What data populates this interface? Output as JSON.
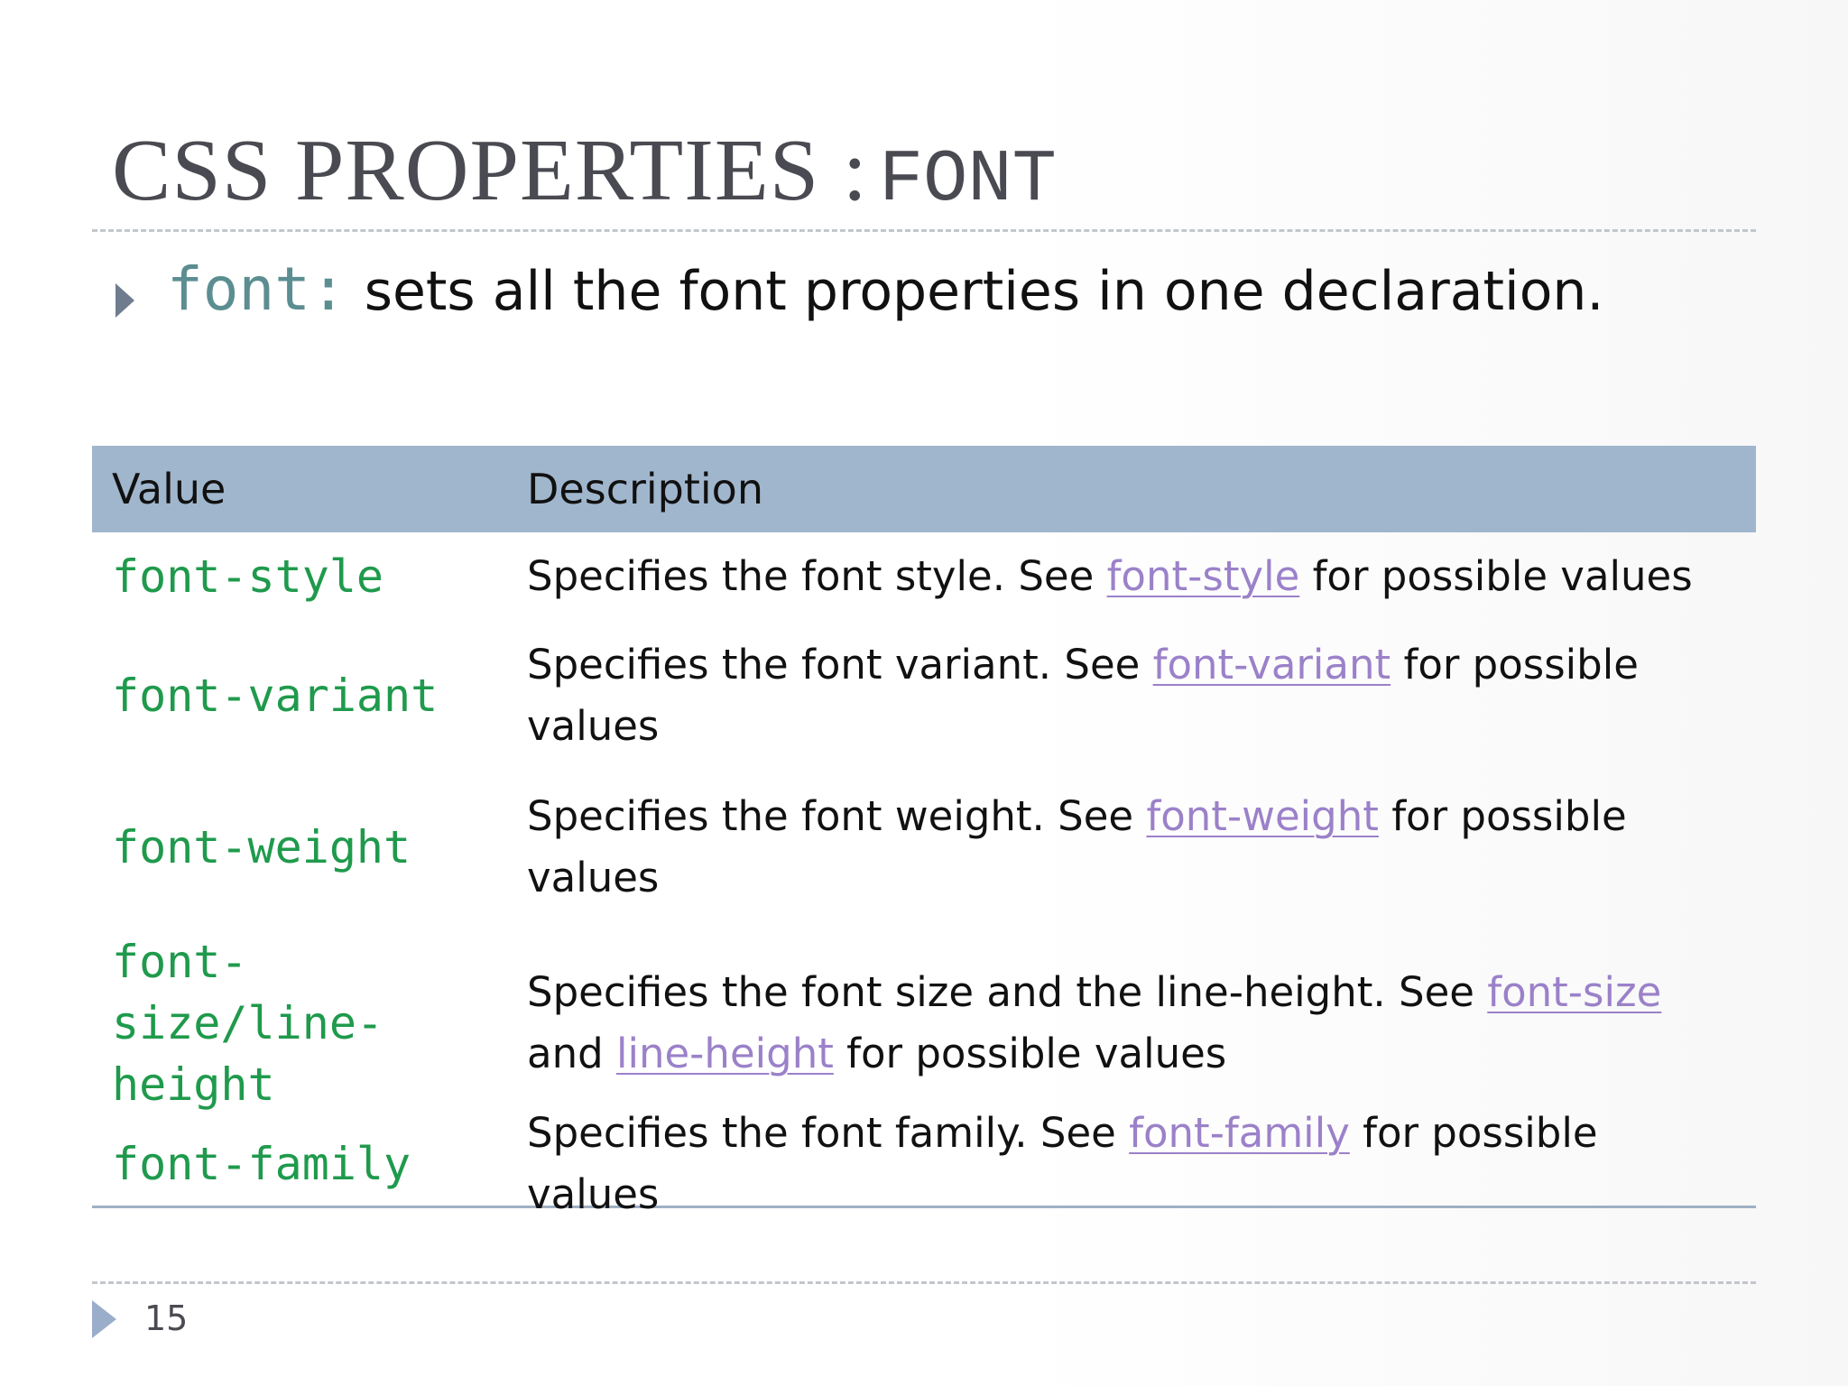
{
  "slide": {
    "title_main": "CSS PROPERTIES :",
    "title_code": "FONT",
    "bullet": {
      "code": "font:",
      "text": "sets all the font properties in one declaration."
    },
    "table": {
      "headers": {
        "value": "Value",
        "description": "Description"
      },
      "rows": [
        {
          "value": "font-style",
          "desc_before": "Specifies the font style. See ",
          "link": "font-style",
          "desc_after": " for possible values"
        },
        {
          "value": "font-variant",
          "desc_before": "Specifies the font variant. See ",
          "link": "font-variant",
          "desc_after": " for possible values"
        },
        {
          "value": "font-weight",
          "desc_before": "Specifies the font weight. See ",
          "link": "font-weight",
          "desc_after": " for possible values"
        },
        {
          "value_lines": [
            "font-",
            "size/line-",
            "height"
          ],
          "desc_before": "Specifies the font size and the line-height. See ",
          "link": "font-size",
          "desc_middle": " and ",
          "link2": "line-height",
          "desc_after": " for possible values"
        },
        {
          "value": "font-family",
          "desc_before": "Specifies the font family. See ",
          "link": "font-family",
          "desc_after": " for possible values"
        }
      ]
    },
    "page_number": "15"
  },
  "colors": {
    "title": "#4a4a52",
    "code_green": "#1f9a4c",
    "bullet_code": "#5c8e91",
    "link": "#9b81c9",
    "header_bg": "#a0b6cd"
  },
  "icons": {
    "bullet": "triangle-right-icon",
    "footer": "triangle-right-icon"
  }
}
